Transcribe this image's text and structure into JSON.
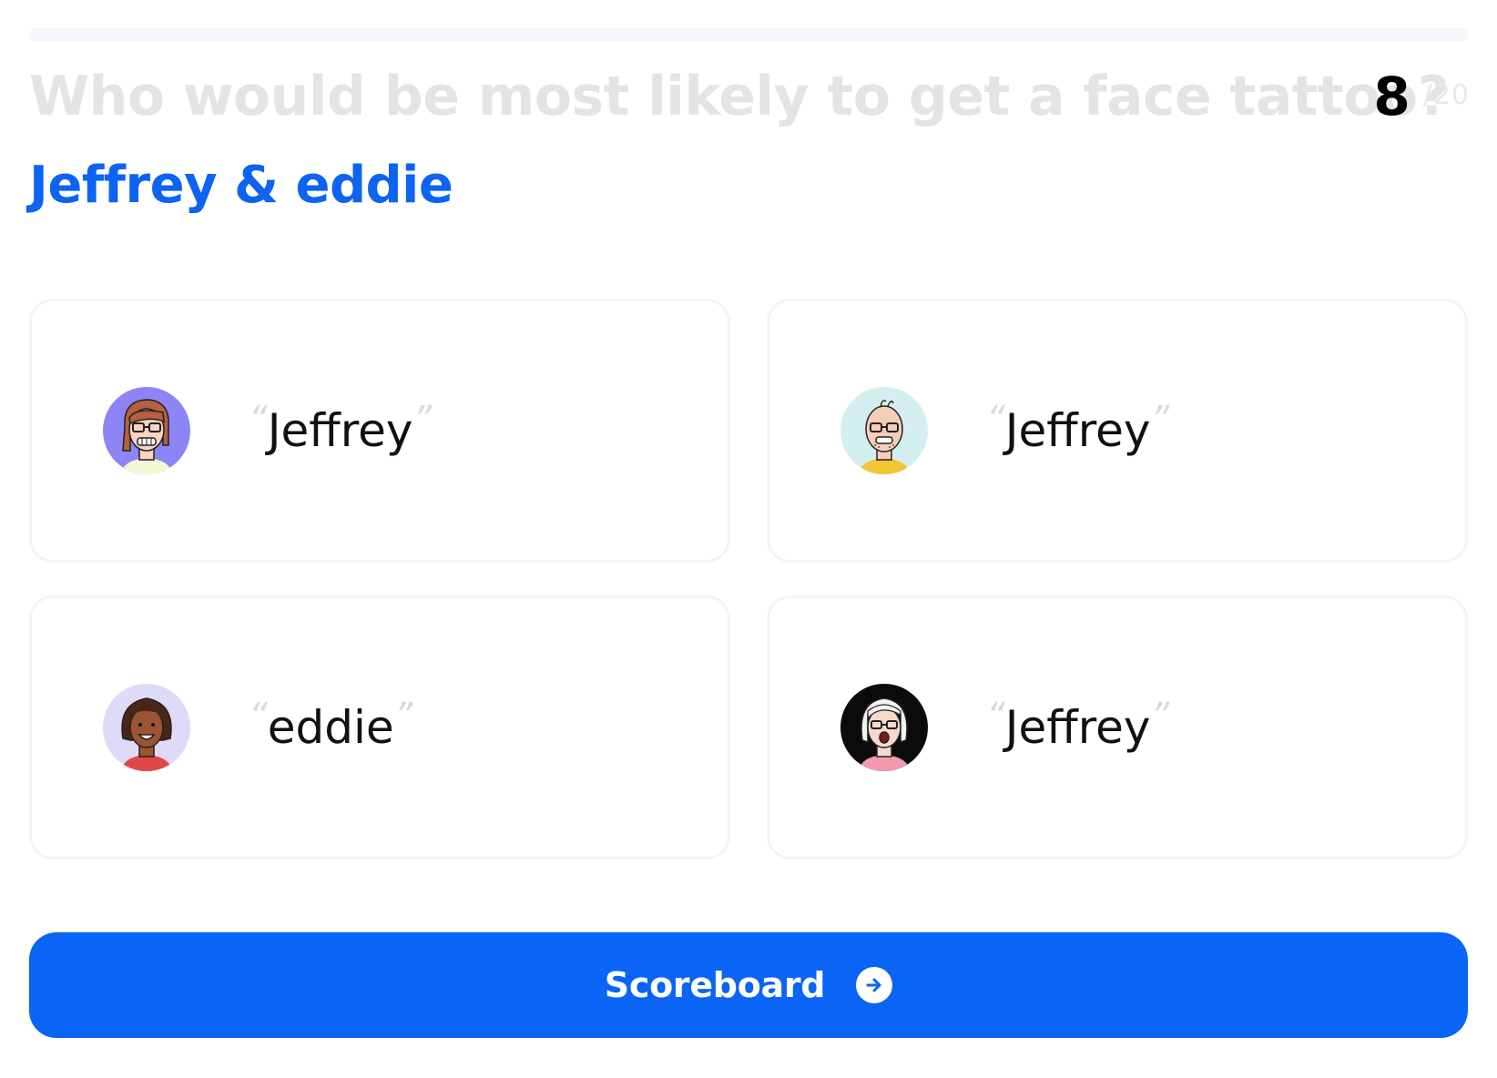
{
  "progress": {
    "current": "8",
    "total": "/20",
    "fraction": 0.0
  },
  "question": "Who would be most likely to get a face tattoo?",
  "answer": "Jeffrey & eddie",
  "quote_open": "“",
  "quote_close": "”",
  "cards": [
    {
      "avatar": "avatar-icon-purple-glasses",
      "guess": "Jeffrey"
    },
    {
      "avatar": "avatar-icon-bald-glasses",
      "guess": "Jeffrey"
    },
    {
      "avatar": "avatar-icon-curly-hair",
      "guess": "eddie"
    },
    {
      "avatar": "avatar-icon-white-hair",
      "guess": "Jeffrey"
    }
  ],
  "button": {
    "label": "Scoreboard",
    "icon": "arrow-right-circle-icon"
  },
  "colors": {
    "accent": "#0a64f5",
    "heading": "#0d63f2",
    "question_faded": "#e4e4e6"
  }
}
